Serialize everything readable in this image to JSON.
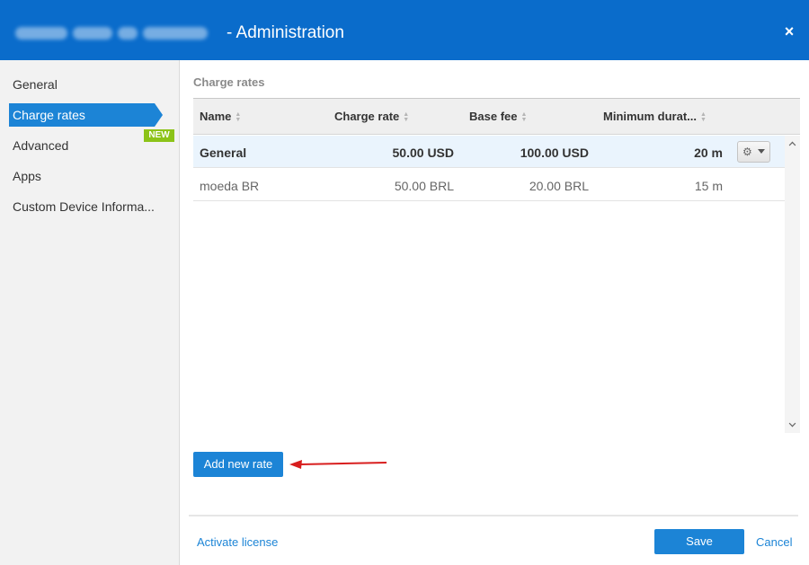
{
  "window": {
    "title_suffix": "- Administration",
    "close_glyph": "×"
  },
  "sidebar": {
    "items": [
      {
        "label": "General"
      },
      {
        "label": "Charge rates"
      },
      {
        "label": "Advanced"
      },
      {
        "label": "Apps"
      },
      {
        "label": "Custom Device Informa..."
      }
    ],
    "new_badge": "NEW"
  },
  "main": {
    "section_title": "Charge rates",
    "columns": [
      "Name",
      "Charge rate",
      "Base fee",
      "Minimum durat..."
    ],
    "rows": [
      {
        "name": "General",
        "charge_rate": "50.00 USD",
        "base_fee": "100.00 USD",
        "minimum_duration": "20 m"
      },
      {
        "name": "moeda BR",
        "charge_rate": "50.00 BRL",
        "base_fee": "20.00 BRL",
        "minimum_duration": "15 m"
      }
    ],
    "add_button": "Add new rate"
  },
  "footer": {
    "activate_license": "Activate license",
    "save": "Save",
    "cancel": "Cancel"
  },
  "colors": {
    "header": "#0a6ccb",
    "accent": "#1c84d6",
    "badge": "#8cc318",
    "arrow": "#d81e1e"
  },
  "icons": [
    "close-icon",
    "gear-icon",
    "caret-down-icon",
    "sort-icon",
    "scroll-up-icon",
    "scroll-down-icon",
    "arrow-annotation"
  ]
}
